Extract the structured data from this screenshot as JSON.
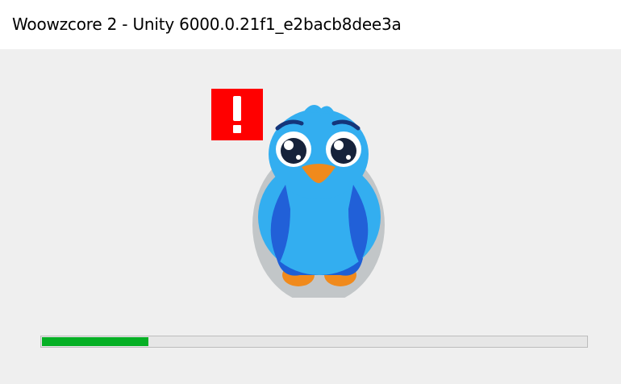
{
  "window": {
    "title": "Woowzcore 2 - Unity 6000.0.21f1_e2bacb8dee3a"
  },
  "splash": {
    "mascot_icon": "blue-bird-mascot-icon",
    "alert_icon": "exclamation-alert-icon",
    "alert_color": "#ff0000"
  },
  "loading": {
    "progress": 0.196,
    "fill_color": "#06b025",
    "track_color": "#e6e6e6"
  }
}
